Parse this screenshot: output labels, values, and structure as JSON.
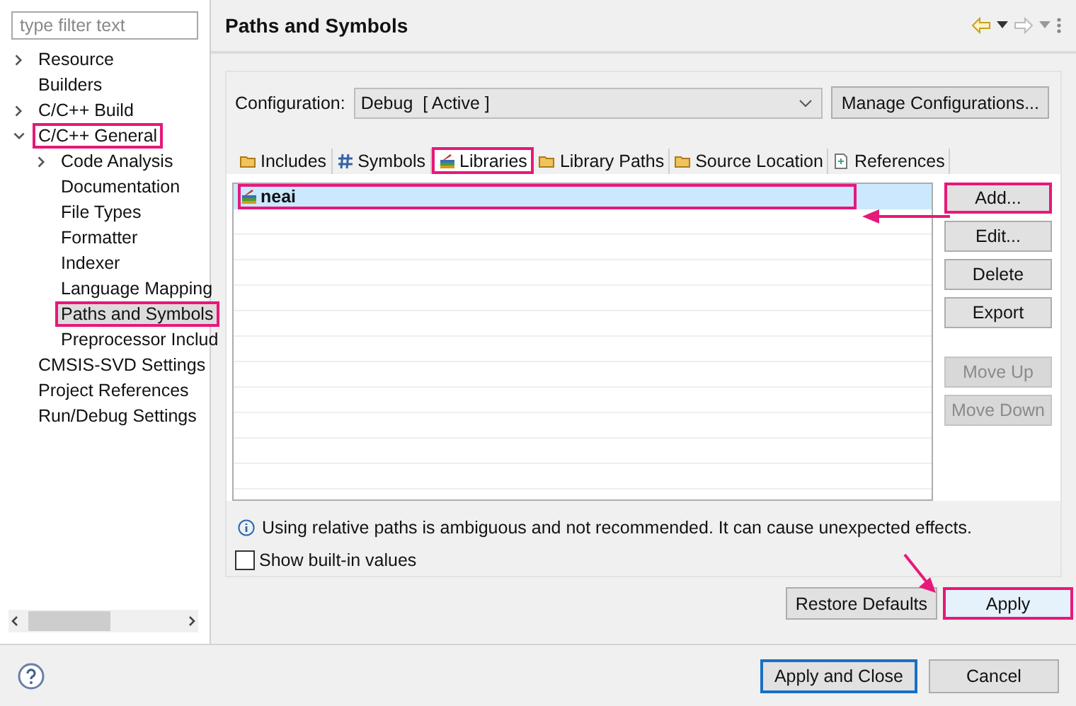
{
  "sidebar": {
    "filter": {
      "placeholder": "type filter text"
    },
    "tree": [
      {
        "label": "Resource",
        "expanded": false,
        "selected": false,
        "highlighted": false
      },
      {
        "label": "Builders",
        "selected": false,
        "highlighted": false
      },
      {
        "label": "C/C++ Build",
        "expanded": false,
        "selected": false,
        "highlighted": false
      },
      {
        "label": "C/C++ General",
        "expanded": true,
        "selected": false,
        "highlighted": true,
        "children": [
          {
            "label": "Code Analysis",
            "expanded": false,
            "selected": false,
            "highlighted": false
          },
          {
            "label": "Documentation",
            "selected": false,
            "highlighted": false
          },
          {
            "label": "File Types",
            "selected": false,
            "highlighted": false
          },
          {
            "label": "Formatter",
            "selected": false,
            "highlighted": false
          },
          {
            "label": "Indexer",
            "selected": false,
            "highlighted": false
          },
          {
            "label": "Language Mapping",
            "selected": false,
            "highlighted": false
          },
          {
            "label": "Paths and Symbols",
            "selected": true,
            "highlighted": true
          },
          {
            "label": "Preprocessor Includ",
            "selected": false,
            "highlighted": false
          }
        ]
      },
      {
        "label": "CMSIS-SVD Settings",
        "selected": false,
        "highlighted": false
      },
      {
        "label": "Project References",
        "selected": false,
        "highlighted": false
      },
      {
        "label": "Run/Debug Settings",
        "selected": false,
        "highlighted": false
      }
    ]
  },
  "page": {
    "title": "Paths and Symbols",
    "configuration": {
      "label": "Configuration:",
      "value": "Debug  [ Active ]",
      "button": "Manage Configurations..."
    },
    "tabs": [
      {
        "label": "Includes",
        "kind": "folder",
        "selected": false,
        "highlighted": false
      },
      {
        "label": "Symbols",
        "kind": "hash",
        "selected": false,
        "highlighted": false
      },
      {
        "label": "Libraries",
        "kind": "books",
        "selected": true,
        "highlighted": true
      },
      {
        "label": "Library Paths",
        "kind": "folder",
        "selected": false,
        "highlighted": false
      },
      {
        "label": "Source Location",
        "kind": "folder",
        "selected": false,
        "highlighted": false
      },
      {
        "label": "References",
        "kind": "page",
        "selected": false,
        "highlighted": false
      }
    ],
    "list": [
      {
        "label": "neai",
        "selected": true,
        "highlighted": true
      }
    ],
    "side_buttons": [
      {
        "label": "Add...",
        "disabled": false,
        "highlighted": true
      },
      {
        "label": "Edit...",
        "disabled": false,
        "highlighted": false
      },
      {
        "label": "Delete",
        "disabled": false,
        "highlighted": false
      },
      {
        "label": "Export",
        "disabled": false,
        "highlighted": false
      },
      {
        "label": "Move Up",
        "disabled": true,
        "highlighted": false
      },
      {
        "label": "Move Down",
        "disabled": true,
        "highlighted": false
      }
    ],
    "info": "Using relative paths is ambiguous and not recommended. It can cause unexpected effects.",
    "show_builtin": {
      "label": "Show built-in values",
      "checked": false
    },
    "buttons": [
      {
        "label": "Restore Defaults",
        "highlighted": false
      },
      {
        "label": "Apply",
        "highlighted": true
      }
    ]
  },
  "footer": {
    "buttons": [
      {
        "label": "Apply and Close",
        "default": true
      },
      {
        "label": "Cancel",
        "default": false
      }
    ]
  }
}
